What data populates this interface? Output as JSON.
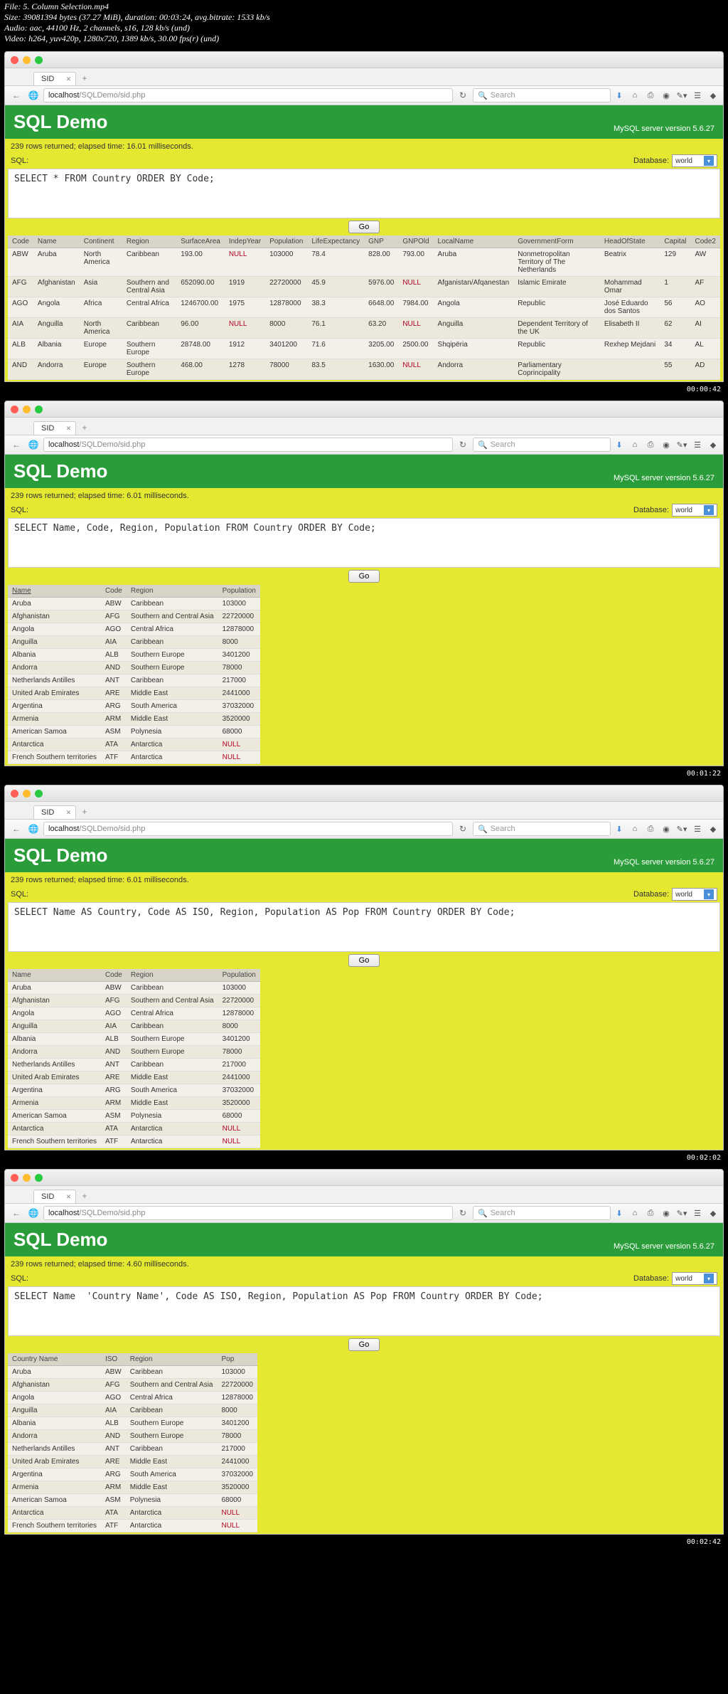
{
  "meta": {
    "l1": "File: 5. Column Selection.mp4",
    "l2": "Size: 39081394 bytes (37.27 MiB), duration: 00:03:24, avg.bitrate: 1533 kb/s",
    "l3": "Audio: aac, 44100 Hz, 2 channels, s16, 128 kb/s (und)",
    "l4": "Video: h264, yuv420p, 1280x720, 1389 kb/s, 30.00 fps(r) (und)"
  },
  "common": {
    "tab_title": "SID",
    "url_text": "localhost/SQLDemo/sid.php",
    "search_placeholder": "Search",
    "title": "SQL Demo",
    "version": "MySQL server version 5.6.27",
    "sql_label": "SQL:",
    "db_label": "Database:",
    "db_value": "world",
    "go": "Go"
  },
  "f1": {
    "status": "239 rows returned; elapsed time: 16.01 milliseconds.",
    "sql": "SELECT * FROM Country ORDER BY Code;",
    "headers": [
      "Code",
      "Name",
      "Continent",
      "Region",
      "SurfaceArea",
      "IndepYear",
      "Population",
      "LifeExpectancy",
      "GNP",
      "GNPOld",
      "LocalName",
      "GovernmentForm",
      "HeadOfState",
      "Capital",
      "Code2"
    ],
    "rows": [
      [
        "ABW",
        "Aruba",
        "North America",
        "Caribbean",
        "193.00",
        "NULL",
        "103000",
        "78.4",
        "828.00",
        "793.00",
        "Aruba",
        "Nonmetropolitan Territory of The Netherlands",
        "Beatrix",
        "129",
        "AW"
      ],
      [
        "AFG",
        "Afghanistan",
        "Asia",
        "Southern and Central Asia",
        "652090.00",
        "1919",
        "22720000",
        "45.9",
        "5976.00",
        "NULL",
        "Afganistan/Afqanestan",
        "Islamic Emirate",
        "Mohammad Omar",
        "1",
        "AF"
      ],
      [
        "AGO",
        "Angola",
        "Africa",
        "Central Africa",
        "1246700.00",
        "1975",
        "12878000",
        "38.3",
        "6648.00",
        "7984.00",
        "Angola",
        "Republic",
        "José Eduardo dos Santos",
        "56",
        "AO"
      ],
      [
        "AIA",
        "Anguilla",
        "North America",
        "Caribbean",
        "96.00",
        "NULL",
        "8000",
        "76.1",
        "63.20",
        "NULL",
        "Anguilla",
        "Dependent Territory of the UK",
        "Elisabeth II",
        "62",
        "AI"
      ],
      [
        "ALB",
        "Albania",
        "Europe",
        "Southern Europe",
        "28748.00",
        "1912",
        "3401200",
        "71.6",
        "3205.00",
        "2500.00",
        "Shqipëria",
        "Republic",
        "Rexhep Mejdani",
        "34",
        "AL"
      ],
      [
        "AND",
        "Andorra",
        "Europe",
        "Southern Europe",
        "468.00",
        "1278",
        "78000",
        "83.5",
        "1630.00",
        "NULL",
        "Andorra",
        "Parliamentary Coprincipality",
        "",
        "55",
        "AD"
      ]
    ],
    "ts": "00:00:42"
  },
  "f2": {
    "status": "239 rows returned; elapsed time: 6.01 milliseconds.",
    "sql": "SELECT Name, Code, Region, Population FROM Country ORDER BY Code;",
    "headers": [
      "Name",
      "Code",
      "Region",
      "Population"
    ],
    "rows": [
      [
        "Aruba",
        "ABW",
        "Caribbean",
        "103000"
      ],
      [
        "Afghanistan",
        "AFG",
        "Southern and Central Asia",
        "22720000"
      ],
      [
        "Angola",
        "AGO",
        "Central Africa",
        "12878000"
      ],
      [
        "Anguilla",
        "AIA",
        "Caribbean",
        "8000"
      ],
      [
        "Albania",
        "ALB",
        "Southern Europe",
        "3401200"
      ],
      [
        "Andorra",
        "AND",
        "Southern Europe",
        "78000"
      ],
      [
        "Netherlands Antilles",
        "ANT",
        "Caribbean",
        "217000"
      ],
      [
        "United Arab Emirates",
        "ARE",
        "Middle East",
        "2441000"
      ],
      [
        "Argentina",
        "ARG",
        "South America",
        "37032000"
      ],
      [
        "Armenia",
        "ARM",
        "Middle East",
        "3520000"
      ],
      [
        "American Samoa",
        "ASM",
        "Polynesia",
        "68000"
      ],
      [
        "Antarctica",
        "ATA",
        "Antarctica",
        "NULL"
      ],
      [
        "French Southern territories",
        "ATF",
        "Antarctica",
        "NULL"
      ]
    ],
    "ts": "00:01:22"
  },
  "f3": {
    "status": "239 rows returned; elapsed time: 6.01 milliseconds.",
    "sql": "SELECT Name AS Country, Code AS ISO, Region, Population AS Pop FROM Country ORDER BY Code;",
    "headers": [
      "Name",
      "Code",
      "Region",
      "Population"
    ],
    "rows": [
      [
        "Aruba",
        "ABW",
        "Caribbean",
        "103000"
      ],
      [
        "Afghanistan",
        "AFG",
        "Southern and Central Asia",
        "22720000"
      ],
      [
        "Angola",
        "AGO",
        "Central Africa",
        "12878000"
      ],
      [
        "Anguilla",
        "AIA",
        "Caribbean",
        "8000"
      ],
      [
        "Albania",
        "ALB",
        "Southern Europe",
        "3401200"
      ],
      [
        "Andorra",
        "AND",
        "Southern Europe",
        "78000"
      ],
      [
        "Netherlands Antilles",
        "ANT",
        "Caribbean",
        "217000"
      ],
      [
        "United Arab Emirates",
        "ARE",
        "Middle East",
        "2441000"
      ],
      [
        "Argentina",
        "ARG",
        "South America",
        "37032000"
      ],
      [
        "Armenia",
        "ARM",
        "Middle East",
        "3520000"
      ],
      [
        "American Samoa",
        "ASM",
        "Polynesia",
        "68000"
      ],
      [
        "Antarctica",
        "ATA",
        "Antarctica",
        "NULL"
      ],
      [
        "French Southern territories",
        "ATF",
        "Antarctica",
        "NULL"
      ]
    ],
    "ts": "00:02:02"
  },
  "f4": {
    "status": "239 rows returned; elapsed time: 4.60 milliseconds.",
    "sql": "SELECT Name  'Country Name', Code AS ISO, Region, Population AS Pop FROM Country ORDER BY Code;",
    "headers": [
      "Country Name",
      "ISO",
      "Region",
      "Pop"
    ],
    "rows": [
      [
        "Aruba",
        "ABW",
        "Caribbean",
        "103000"
      ],
      [
        "Afghanistan",
        "AFG",
        "Southern and Central Asia",
        "22720000"
      ],
      [
        "Angola",
        "AGO",
        "Central Africa",
        "12878000"
      ],
      [
        "Anguilla",
        "AIA",
        "Caribbean",
        "8000"
      ],
      [
        "Albania",
        "ALB",
        "Southern Europe",
        "3401200"
      ],
      [
        "Andorra",
        "AND",
        "Southern Europe",
        "78000"
      ],
      [
        "Netherlands Antilles",
        "ANT",
        "Caribbean",
        "217000"
      ],
      [
        "United Arab Emirates",
        "ARE",
        "Middle East",
        "2441000"
      ],
      [
        "Argentina",
        "ARG",
        "South America",
        "37032000"
      ],
      [
        "Armenia",
        "ARM",
        "Middle East",
        "3520000"
      ],
      [
        "American Samoa",
        "ASM",
        "Polynesia",
        "68000"
      ],
      [
        "Antarctica",
        "ATA",
        "Antarctica",
        "NULL"
      ],
      [
        "French Southern territories",
        "ATF",
        "Antarctica",
        "NULL"
      ]
    ],
    "ts": "00:02:42"
  }
}
